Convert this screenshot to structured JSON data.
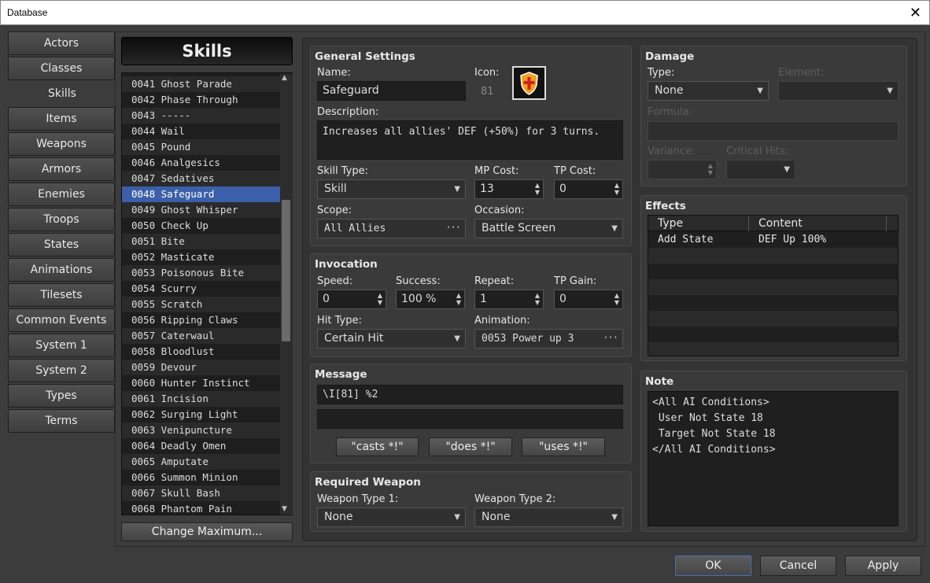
{
  "window": {
    "title": "Database",
    "close": "✕"
  },
  "categories": [
    "Actors",
    "Classes",
    "Skills",
    "Items",
    "Weapons",
    "Armors",
    "Enemies",
    "Troops",
    "States",
    "Animations",
    "Tilesets",
    "Common Events",
    "System 1",
    "System 2",
    "Types",
    "Terms"
  ],
  "list_header": "Skills",
  "skills": [
    {
      "id": "0041",
      "name": "Ghost Parade"
    },
    {
      "id": "0042",
      "name": "Phase Through"
    },
    {
      "id": "0043",
      "name": "-----"
    },
    {
      "id": "0044",
      "name": "Wail"
    },
    {
      "id": "0045",
      "name": "Pound"
    },
    {
      "id": "0046",
      "name": "Analgesics"
    },
    {
      "id": "0047",
      "name": "Sedatives"
    },
    {
      "id": "0048",
      "name": "Safeguard"
    },
    {
      "id": "0049",
      "name": "Ghost Whisper"
    },
    {
      "id": "0050",
      "name": "Check Up"
    },
    {
      "id": "0051",
      "name": "Bite"
    },
    {
      "id": "0052",
      "name": "Masticate"
    },
    {
      "id": "0053",
      "name": "Poisonous Bite"
    },
    {
      "id": "0054",
      "name": "Scurry"
    },
    {
      "id": "0055",
      "name": "Scratch"
    },
    {
      "id": "0056",
      "name": "Ripping Claws"
    },
    {
      "id": "0057",
      "name": "Caterwaul"
    },
    {
      "id": "0058",
      "name": "Bloodlust"
    },
    {
      "id": "0059",
      "name": "Devour"
    },
    {
      "id": "0060",
      "name": "Hunter Instinct"
    },
    {
      "id": "0061",
      "name": "Incision"
    },
    {
      "id": "0062",
      "name": "Surging Light"
    },
    {
      "id": "0063",
      "name": "Venipuncture"
    },
    {
      "id": "0064",
      "name": "Deadly Omen"
    },
    {
      "id": "0065",
      "name": "Amputate"
    },
    {
      "id": "0066",
      "name": "Summon Minion"
    },
    {
      "id": "0067",
      "name": "Skull Bash"
    },
    {
      "id": "0068",
      "name": "Phantom Pain"
    }
  ],
  "change_max": "Change Maximum...",
  "general": {
    "title": "General Settings",
    "name_label": "Name:",
    "name": "Safeguard",
    "icon_label": "Icon:",
    "icon_index": "81",
    "desc_label": "Description:",
    "desc": "Increases all allies' DEF (+50%) for 3 turns.",
    "skilltype_label": "Skill Type:",
    "skilltype": "Skill",
    "mpcost_label": "MP Cost:",
    "mpcost": "13",
    "tpcost_label": "TP Cost:",
    "tpcost": "0",
    "scope_label": "Scope:",
    "scope": "All Allies",
    "occasion_label": "Occasion:",
    "occasion": "Battle Screen"
  },
  "invocation": {
    "title": "Invocation",
    "speed_label": "Speed:",
    "speed": "0",
    "success_label": "Success:",
    "success": "100 %",
    "repeat_label": "Repeat:",
    "repeat": "1",
    "tpgain_label": "TP Gain:",
    "tpgain": "0",
    "hittype_label": "Hit Type:",
    "hittype": "Certain Hit",
    "animation_label": "Animation:",
    "animation": "0053 Power up 3"
  },
  "message": {
    "title": "Message",
    "line1": "\\I[81] %2",
    "line2": "",
    "btn_casts": "\"casts *!\"",
    "btn_does": "\"does *!\"",
    "btn_uses": "\"uses *!\""
  },
  "weapon": {
    "title": "Required Weapon",
    "type1_label": "Weapon Type 1:",
    "type1": "None",
    "type2_label": "Weapon Type 2:",
    "type2": "None"
  },
  "damage": {
    "title": "Damage",
    "type_label": "Type:",
    "type": "None",
    "element_label": "Element:",
    "formula_label": "Formula:",
    "variance_label": "Variance:",
    "critical_label": "Critical Hits:"
  },
  "effects": {
    "title": "Effects",
    "col_type": "Type",
    "col_content": "Content",
    "rows": [
      {
        "type": "Add State",
        "content": "DEF Up 100%"
      }
    ]
  },
  "note": {
    "title": "Note",
    "lines": [
      "<All AI Conditions>",
      " User Not State 18",
      " Target Not State 18",
      "</All AI Conditions>"
    ]
  },
  "buttons": {
    "ok": "OK",
    "cancel": "Cancel",
    "apply": "Apply"
  },
  "colors": {
    "selection": "#3b5fa8",
    "icon_shield": "#f0a020",
    "icon_cross": "#d02020"
  }
}
